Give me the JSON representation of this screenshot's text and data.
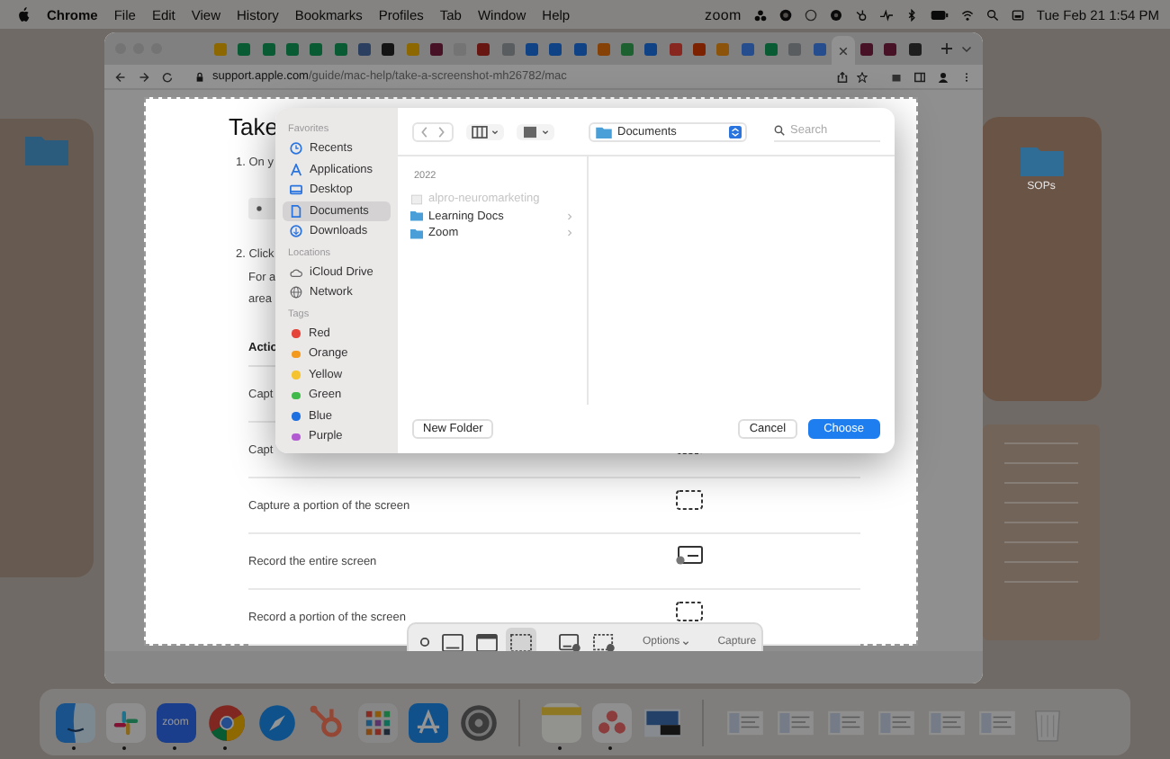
{
  "menu_bar": {
    "app": "Chrome",
    "menus": [
      "File",
      "Edit",
      "View",
      "History",
      "Bookmarks",
      "Profiles",
      "Tab",
      "Window",
      "Help"
    ],
    "zoom_label": "zoom",
    "clock": "Tue Feb 21  1:54 PM"
  },
  "desktop": {
    "folders": [
      {
        "label": "SOPs"
      }
    ]
  },
  "browser": {
    "tabs": [
      {
        "color": "#8d6800",
        "selected": false
      },
      {
        "color": "#095b33",
        "selected": false
      },
      {
        "color": "#095b33",
        "selected": false
      },
      {
        "color": "#095b33",
        "selected": false
      },
      {
        "color": "#095b33",
        "selected": false
      },
      {
        "color": "#095b33",
        "selected": false
      },
      {
        "color": "#2b4060",
        "selected": false
      },
      {
        "color": "#141414",
        "selected": false
      },
      {
        "color": "#8d6800",
        "selected": false
      },
      {
        "color": "#471225",
        "selected": false
      },
      {
        "color": "#747474",
        "selected": false
      },
      {
        "color": "#681611",
        "selected": false
      },
      {
        "color": "#595d60",
        "selected": false
      },
      {
        "color": "#0f4386",
        "selected": false
      },
      {
        "color": "#0f4386",
        "selected": false
      },
      {
        "color": "#0f4386",
        "selected": false
      },
      {
        "color": "#864106",
        "selected": false
      },
      {
        "color": "#1e6130",
        "selected": false
      },
      {
        "color": "#0f4386",
        "selected": false
      },
      {
        "color": "#872720",
        "selected": false
      },
      {
        "color": "#7d2201",
        "selected": false
      },
      {
        "color": "#8c540a",
        "selected": false
      },
      {
        "color": "#264d8d",
        "selected": false
      },
      {
        "color": "#095b33",
        "selected": false
      },
      {
        "color": "#595d60",
        "selected": false
      },
      {
        "color": "#264d8d",
        "selected": false
      },
      {
        "selected": true
      },
      {
        "color": "#471225",
        "selected": false
      },
      {
        "color": "#471225",
        "selected": false
      },
      {
        "color": "#1e1e1e",
        "selected": false
      }
    ],
    "url_host": "support.apple.com",
    "url_path": "/guide/mac-help/take-a-screenshot-mh26782/mac",
    "page": {
      "title": "Take",
      "blocks": [
        {
          "kind": "step",
          "text": "1. On y"
        },
        {
          "kind": "key"
        },
        {
          "kind": "step",
          "text": "2. Click"
        },
        {
          "kind": "para",
          "text": "For a"
        },
        {
          "kind": "para",
          "text": "area"
        }
      ],
      "table": {
        "header": "Actio",
        "rows": [
          {
            "kind": "plain",
            "action": "Capt"
          },
          {
            "kind": "portion",
            "action": "Capt"
          },
          {
            "kind": "portion",
            "action": "Capture a portion of the screen"
          },
          {
            "kind": "record",
            "action": "Record the entire screen"
          },
          {
            "kind": "portion",
            "action": "Record a portion of the screen"
          }
        ]
      }
    }
  },
  "file_dialog": {
    "sections": [
      {
        "title": "Favorites",
        "items": [
          {
            "kind": "clock",
            "label": "Recents",
            "selected": false
          },
          {
            "kind": "apps",
            "label": "Applications",
            "selected": false
          },
          {
            "kind": "desktop",
            "label": "Desktop",
            "selected": false
          },
          {
            "kind": "doc",
            "label": "Documents",
            "selected": true
          },
          {
            "kind": "download",
            "label": "Downloads",
            "selected": false
          }
        ]
      },
      {
        "title": "Locations",
        "items": [
          {
            "kind": "cloud",
            "label": "iCloud Drive",
            "selected": false
          },
          {
            "kind": "globe",
            "label": "Network",
            "selected": false
          }
        ]
      },
      {
        "title": "Tags",
        "items": [
          {
            "kind": "tag",
            "label": "Red",
            "color": "#e5443b",
            "selected": false
          },
          {
            "kind": "tag",
            "label": "Orange",
            "color": "#f39a1e",
            "selected": false
          },
          {
            "kind": "tag",
            "label": "Yellow",
            "color": "#f5c330",
            "selected": false
          },
          {
            "kind": "tag",
            "label": "Green",
            "color": "#3fb94a",
            "selected": false
          },
          {
            "kind": "tag",
            "label": "Blue",
            "color": "#1e6fe0",
            "selected": false
          },
          {
            "kind": "tag",
            "label": "Purple",
            "color": "#b25ad1",
            "selected": false
          }
        ]
      }
    ],
    "location": "Documents",
    "search_placeholder": "Search",
    "group": "2022",
    "files": [
      {
        "kind": "file",
        "name": "alpro-neuromarketing",
        "disabled": true
      },
      {
        "kind": "folder",
        "name": "Learning Docs",
        "disabled": false
      },
      {
        "kind": "folder",
        "name": "Zoom",
        "disabled": false
      }
    ],
    "new_folder": "New Folder",
    "cancel": "Cancel",
    "choose": "Choose"
  },
  "screenshot_toolbar": {
    "tools": [
      {
        "kind": "close",
        "selected": false
      },
      {
        "kind": "entire",
        "selected": false
      },
      {
        "kind": "window",
        "selected": false
      },
      {
        "kind": "portion",
        "selected": true
      },
      {
        "kind": "record-entire",
        "selected": false
      },
      {
        "kind": "record-portion",
        "selected": false
      }
    ],
    "options": "Options",
    "capture": "Capture"
  },
  "dock": {
    "apps": [
      {
        "kind": "finder",
        "running": true
      },
      {
        "kind": "slack",
        "running": true
      },
      {
        "kind": "zoom",
        "label": "zoom",
        "running": true
      },
      {
        "kind": "chrome",
        "running": true
      },
      {
        "kind": "safari",
        "running": false
      },
      {
        "kind": "hubspot",
        "running": false
      },
      {
        "kind": "launchpad",
        "running": false
      },
      {
        "kind": "appstore",
        "running": false
      },
      {
        "kind": "settings",
        "running": false
      }
    ],
    "docs": [
      {
        "kind": "notes",
        "running": true
      },
      {
        "kind": "asana",
        "running": true
      },
      {
        "kind": "preview",
        "running": false
      }
    ],
    "windows": [
      {
        "kind": "thumb"
      },
      {
        "kind": "thumb"
      },
      {
        "kind": "thumb"
      },
      {
        "kind": "thumb"
      },
      {
        "kind": "thumb"
      },
      {
        "kind": "thumb"
      }
    ]
  }
}
